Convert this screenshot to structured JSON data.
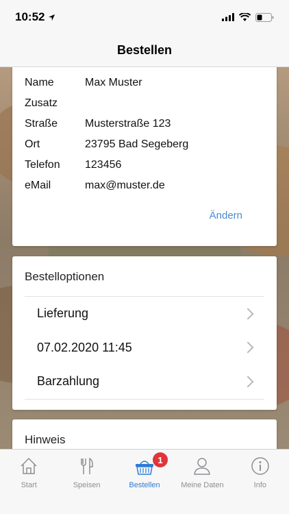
{
  "status_bar": {
    "time": "10:52"
  },
  "header": {
    "title": "Bestellen"
  },
  "address": {
    "rows": [
      {
        "label": "Name",
        "value": "Max Muster"
      },
      {
        "label": "Zusatz",
        "value": ""
      },
      {
        "label": "Straße",
        "value": "Musterstraße 123"
      },
      {
        "label": "Ort",
        "value": "23795 Bad Segeberg"
      },
      {
        "label": "Telefon",
        "value": "123456"
      },
      {
        "label": "eMail",
        "value": "max@muster.de"
      }
    ],
    "change_label": "Ändern"
  },
  "options": {
    "title": "Bestelloptionen",
    "items": [
      {
        "label": "Lieferung"
      },
      {
        "label": "07.02.2020 11:45"
      },
      {
        "label": "Barzahlung"
      }
    ]
  },
  "note": {
    "title": "Hinweis"
  },
  "tabs": [
    {
      "label": "Start",
      "icon": "home-icon"
    },
    {
      "label": "Speisen",
      "icon": "cutlery-icon"
    },
    {
      "label": "Bestellen",
      "icon": "basket-icon",
      "badge": "1",
      "active": true
    },
    {
      "label": "Meine Daten",
      "icon": "user-icon"
    },
    {
      "label": "Info",
      "icon": "info-icon"
    }
  ],
  "colors": {
    "accent": "#2f7bd6",
    "link": "#4a8bd6",
    "badge": "#e0353b"
  }
}
